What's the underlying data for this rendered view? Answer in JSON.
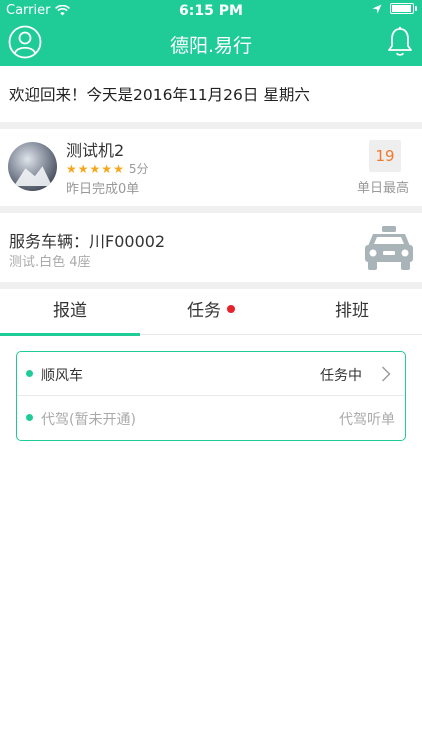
{
  "status_bar": {
    "carrier": "Carrier",
    "time": "6:15 PM"
  },
  "navbar": {
    "title": "德阳.易行"
  },
  "welcome": {
    "text": "欢迎回来！今天是2016年11月26日  星期六"
  },
  "driver": {
    "name": "测试机2",
    "rating": 5,
    "score_text": "5分",
    "yesterday_text": "昨日完成0单",
    "record_value": "19",
    "record_label": "单日最高"
  },
  "vehicle": {
    "label": "服务车辆：川F00002",
    "sub": "测试.白色    4座"
  },
  "tabs": [
    {
      "label": "报道",
      "active": true
    },
    {
      "label": "任务",
      "badge": true
    },
    {
      "label": "排班"
    }
  ],
  "services": [
    {
      "name": "顺风车",
      "status": "任务中"
    },
    {
      "name": "代驾(暂未开通)",
      "status": "代驾听单"
    }
  ],
  "colors": {
    "accent": "#1fcc98",
    "record": "#f07a2b",
    "badge": "#e8222b",
    "star": "#f5a81c"
  }
}
